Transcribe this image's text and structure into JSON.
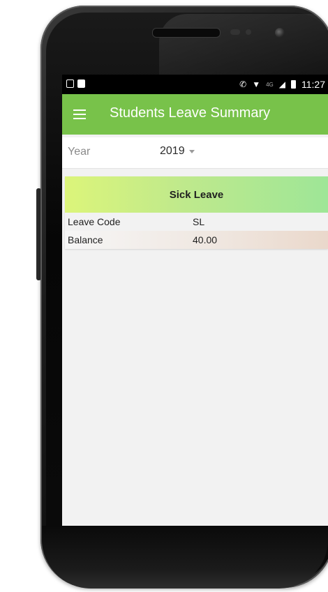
{
  "status_bar": {
    "time": "11:27",
    "network_label": "4G",
    "icons": [
      "screen-record-icon",
      "image-icon",
      "call-icon",
      "wifi-icon",
      "signal-icon",
      "battery-icon"
    ]
  },
  "app_bar": {
    "title": "Students Leave Summary",
    "color": "#78c24a",
    "menu_icon": "hamburger-menu-icon"
  },
  "filter": {
    "year_label": "Year",
    "year_value": "2019"
  },
  "leave_card": {
    "title": "Sick Leave",
    "rows": [
      {
        "label": "Leave Code",
        "value": "SL"
      },
      {
        "label": "Balance",
        "value": "40.00"
      }
    ]
  }
}
